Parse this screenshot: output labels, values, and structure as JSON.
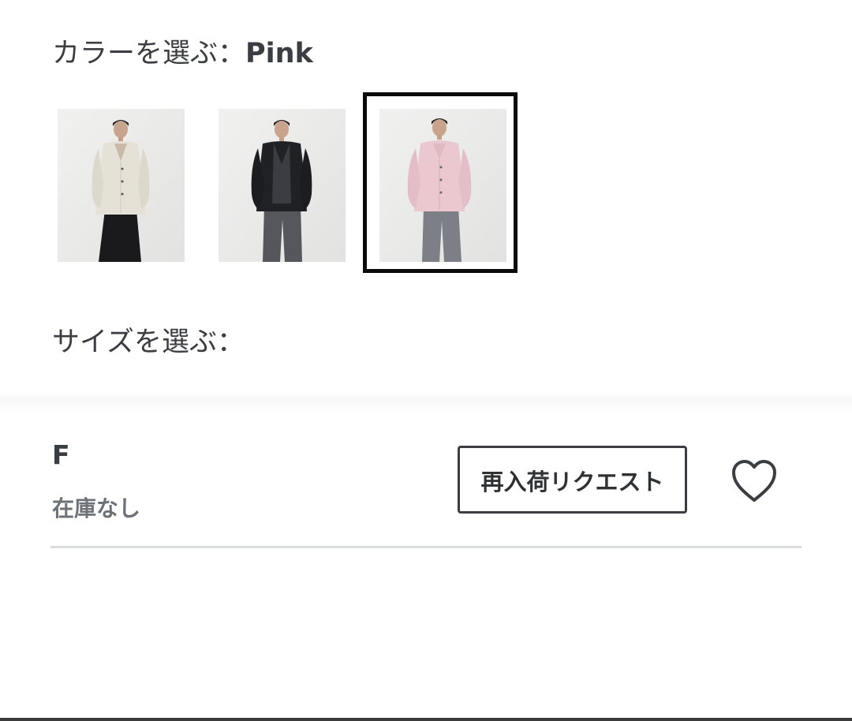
{
  "color_selector": {
    "label": "カラーを選ぶ：",
    "selected": "Pink",
    "swatches": [
      {
        "color": "#e9e5dc",
        "icon": "offwhite-cardigan-photo"
      },
      {
        "color": "#1d1f22",
        "icon": "black-cardigan-photo"
      },
      {
        "color": "#e8c6cf",
        "icon": "pink-cardigan-photo"
      }
    ]
  },
  "size_selector": {
    "label": "サイズを選ぶ：",
    "sizes": [
      {
        "name": "F",
        "status": "在庫なし",
        "restock_label": "再入荷リクエスト",
        "favorite_icon": "heart-outline-icon"
      }
    ]
  },
  "colors": {
    "text": "#3a3d41",
    "muted": "#6c7277",
    "divider": "#d9dbdd",
    "selected_border": "#0a0a0a"
  }
}
